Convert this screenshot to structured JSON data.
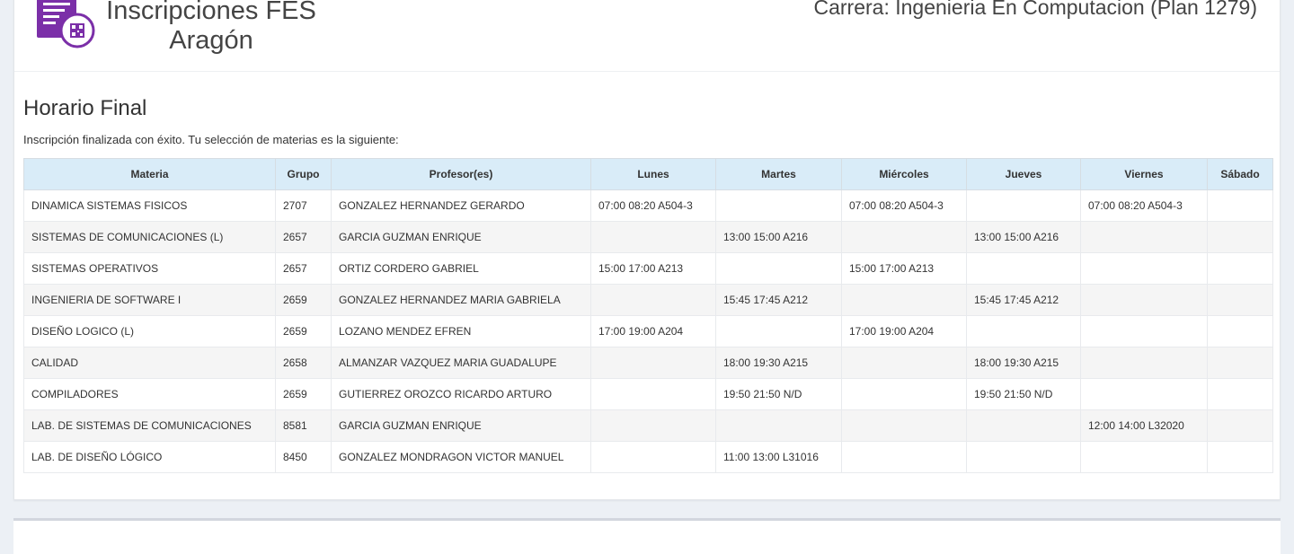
{
  "header": {
    "title": "Inscripciones FES Aragón",
    "career": "Carrera: Ingenieria En Computacion (Plan 1279)"
  },
  "section": {
    "title": "Horario Final",
    "message": "Inscripción finalizada con éxito. Tu selección de materias es la siguiente:"
  },
  "colors": {
    "brand": "#7b2fa8",
    "table_header_bg": "#d9ecf8"
  },
  "table": {
    "columns": [
      "Materia",
      "Grupo",
      "Profesor(es)",
      "Lunes",
      "Martes",
      "Miércoles",
      "Jueves",
      "Viernes",
      "Sábado"
    ],
    "rows": [
      [
        "DINAMICA SISTEMAS FISICOS",
        "2707",
        "GONZALEZ HERNANDEZ GERARDO",
        "07:00 08:20 A504-3",
        "",
        "07:00 08:20 A504-3",
        "",
        "07:00 08:20 A504-3",
        ""
      ],
      [
        "SISTEMAS DE COMUNICACIONES (L)",
        "2657",
        "GARCIA GUZMAN ENRIQUE",
        "",
        "13:00 15:00 A216",
        "",
        "13:00 15:00 A216",
        "",
        ""
      ],
      [
        "SISTEMAS OPERATIVOS",
        "2657",
        "ORTIZ CORDERO GABRIEL",
        "15:00 17:00 A213",
        "",
        "15:00 17:00 A213",
        "",
        "",
        ""
      ],
      [
        "INGENIERIA DE SOFTWARE I",
        "2659",
        "GONZALEZ HERNANDEZ MARIA GABRIELA",
        "",
        "15:45 17:45 A212",
        "",
        "15:45 17:45 A212",
        "",
        ""
      ],
      [
        "DISEÑO LOGICO (L)",
        "2659",
        "LOZANO MENDEZ EFREN",
        "17:00 19:00 A204",
        "",
        "17:00 19:00 A204",
        "",
        "",
        ""
      ],
      [
        "CALIDAD",
        "2658",
        "ALMANZAR VAZQUEZ MARIA GUADALUPE",
        "",
        "18:00 19:30 A215",
        "",
        "18:00 19:30 A215",
        "",
        ""
      ],
      [
        "COMPILADORES",
        "2659",
        "GUTIERREZ OROZCO RICARDO ARTURO",
        "",
        "19:50 21:50 N/D",
        "",
        "19:50 21:50 N/D",
        "",
        ""
      ],
      [
        "LAB. DE SISTEMAS DE COMUNICACIONES",
        "8581",
        "GARCIA GUZMAN ENRIQUE",
        "",
        "",
        "",
        "",
        "12:00 14:00 L32020",
        ""
      ],
      [
        "LAB. DE DISEÑO LÓGICO",
        "8450",
        "GONZALEZ MONDRAGON VICTOR MANUEL",
        "",
        "11:00 13:00 L31016",
        "",
        "",
        "",
        ""
      ]
    ]
  }
}
